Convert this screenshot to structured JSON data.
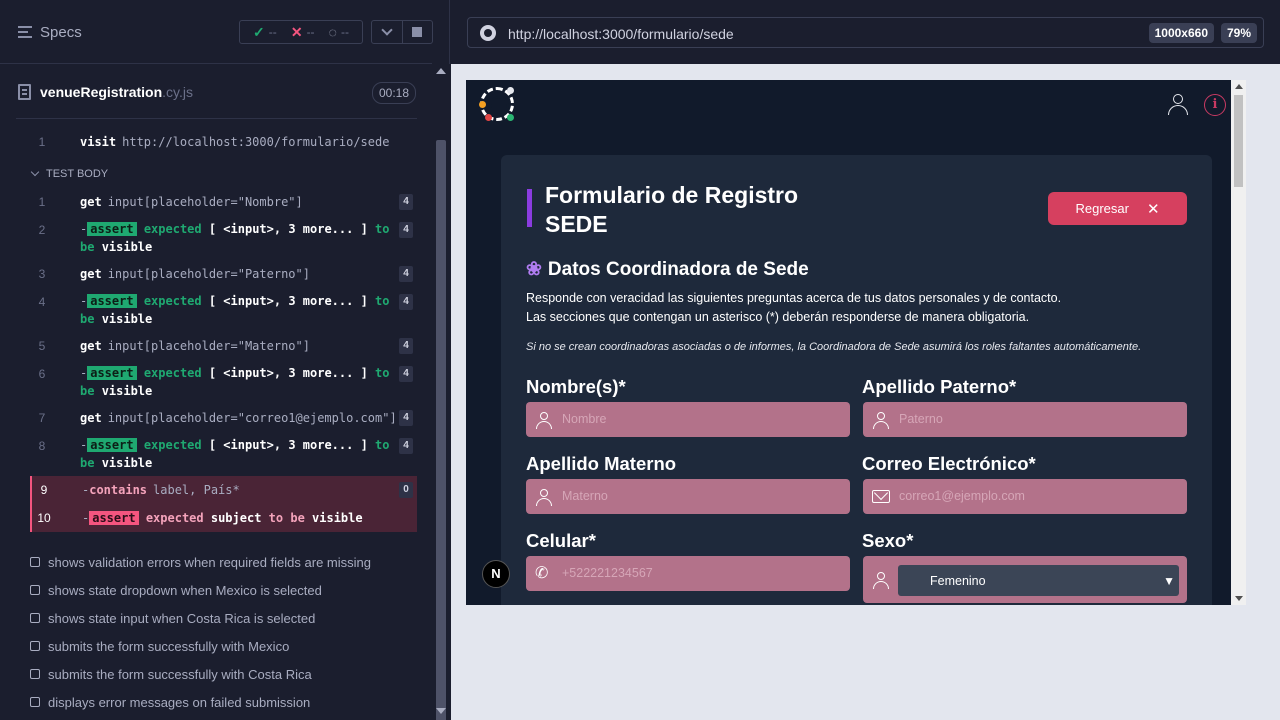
{
  "runner": {
    "header": {
      "title": "Specs"
    },
    "status": {
      "passed": "--",
      "failed": "--",
      "pending": "--"
    },
    "spec_file": {
      "name": "venueRegistration",
      "ext": ".cy.js",
      "duration": "00:18"
    },
    "visit_command": {
      "num": "1",
      "name": "visit",
      "arg": "http://localhost:3000/formulario/sede"
    },
    "test_body_label": "TEST BODY",
    "commands": [
      {
        "num": "1",
        "name": "get",
        "arg": "input[placeholder=\"Nombre\"]",
        "badge": "4"
      },
      {
        "num": "2",
        "dash": "-",
        "tag": "assert",
        "text": "expected",
        "subject": "[ <input>, 3 more... ]",
        "to": "to",
        "be": "be",
        "visible": "visible",
        "badge": "4"
      },
      {
        "num": "3",
        "name": "get",
        "arg": "input[placeholder=\"Paterno\"]",
        "badge": "4"
      },
      {
        "num": "4",
        "dash": "-",
        "tag": "assert",
        "text": "expected",
        "subject": "[ <input>, 3 more... ]",
        "to": "to",
        "be": "be",
        "visible": "visible",
        "badge": "4"
      },
      {
        "num": "5",
        "name": "get",
        "arg": "input[placeholder=\"Materno\"]",
        "badge": "4"
      },
      {
        "num": "6",
        "dash": "-",
        "tag": "assert",
        "text": "expected",
        "subject": "[ <input>, 3 more... ]",
        "to": "to",
        "be": "be",
        "visible": "visible",
        "badge": "4"
      },
      {
        "num": "7",
        "name": "get",
        "arg": "input[placeholder=\"correo1@ejemplo.com\"]",
        "badge": "4"
      },
      {
        "num": "8",
        "dash": "-",
        "tag": "assert",
        "text": "expected",
        "subject": "[ <input>, 3 more... ]",
        "to": "to",
        "be": "be",
        "visible": "visible",
        "badge": "4"
      },
      {
        "num": "9",
        "dash": "-",
        "name": "contains",
        "arg": "label, País*",
        "badge": "0"
      },
      {
        "num": "10",
        "dash": "-",
        "tag": "assert",
        "text": "expected",
        "subject": "subject",
        "to": "to be",
        "visible": "visible"
      }
    ],
    "tests": [
      "shows validation errors when required fields are missing",
      "shows state dropdown when Mexico is selected",
      "shows state input when Costa Rica is selected",
      "submits the form successfully with Mexico",
      "submits the form successfully with Costa Rica",
      "displays error messages on failed submission"
    ]
  },
  "browser": {
    "url": "http://localhost:3000/formulario/sede",
    "viewport": "1000x660",
    "zoom": "79%"
  },
  "app": {
    "title_line1": "Formulario de Registro",
    "title_line2": "SEDE",
    "back_button": "Regresar",
    "back_icon": "✕",
    "section_icon": "❀",
    "section_title": "Datos Coordinadora de Sede",
    "desc_line1": "Responde con veracidad las siguientes preguntas acerca de tus datos personales y de contacto.",
    "desc_line2": "Las secciones que contengan un asterisco (*) deberán responderse de manera obligatoria.",
    "note": "Si no se crean coordinadoras asociadas o de informes, la Coordinadora de Sede asumirá los roles faltantes automáticamente.",
    "fields": {
      "nombre": {
        "label": "Nombre(s)*",
        "placeholder": "Nombre"
      },
      "paterno": {
        "label": "Apellido Paterno*",
        "placeholder": "Paterno"
      },
      "materno": {
        "label": "Apellido Materno",
        "placeholder": "Materno"
      },
      "correo": {
        "label": "Correo Electrónico*",
        "placeholder": "correo1@ejemplo.com"
      },
      "celular": {
        "label": "Celular*",
        "placeholder": "+522221234567"
      },
      "sexo": {
        "label": "Sexo*",
        "value": "Femenino"
      }
    },
    "next_badge": "N",
    "info_icon": "i"
  }
}
